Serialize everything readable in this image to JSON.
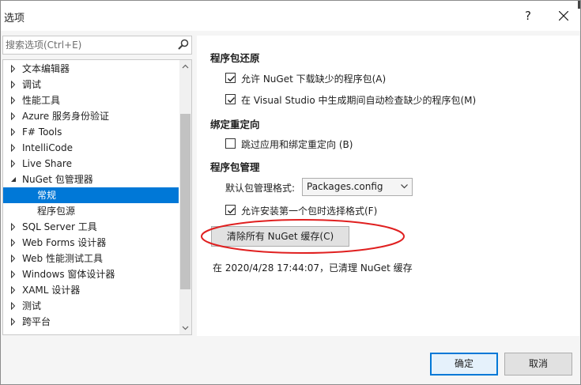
{
  "window": {
    "title": "选项",
    "help": "?"
  },
  "search": {
    "placeholder": "搜索选项(Ctrl+E)"
  },
  "tree": {
    "items": [
      {
        "label": "文本编辑器",
        "expanded": false
      },
      {
        "label": "调试",
        "expanded": false
      },
      {
        "label": "性能工具",
        "expanded": false
      },
      {
        "label": "Azure 服务身份验证",
        "expanded": false
      },
      {
        "label": "F# Tools",
        "expanded": false
      },
      {
        "label": "IntelliCode",
        "expanded": false
      },
      {
        "label": "Live Share",
        "expanded": false
      },
      {
        "label": "NuGet 包管理器",
        "expanded": true
      },
      {
        "label": "常规",
        "child": true,
        "selected": true
      },
      {
        "label": "程序包源",
        "child": true
      },
      {
        "label": "SQL Server 工具",
        "expanded": false
      },
      {
        "label": "Web Forms 设计器",
        "expanded": false
      },
      {
        "label": "Web 性能测试工具",
        "expanded": false
      },
      {
        "label": "Windows 窗体设计器",
        "expanded": false
      },
      {
        "label": "XAML 设计器",
        "expanded": false
      },
      {
        "label": "测试",
        "expanded": false
      },
      {
        "label": "跨平台",
        "expanded": false
      }
    ]
  },
  "panel": {
    "restore": {
      "title": "程序包还原",
      "allow_download": {
        "label": "允许 NuGet 下载缺少的程序包(A)",
        "checked": true
      },
      "check_on_build": {
        "label": "在 Visual Studio 中生成期间自动检查缺少的程序包(M)",
        "checked": true
      }
    },
    "binding": {
      "title": "绑定重定向",
      "skip": {
        "label": "跳过应用和绑定重定向 (B)",
        "checked": false
      }
    },
    "management": {
      "title": "程序包管理",
      "format_label": "默认包管理格式:",
      "format_value": "Packages.config",
      "allow_choose": {
        "label": "允许安装第一个包时选择格式(F)",
        "checked": true
      },
      "clear_button": "清除所有 NuGet 缓存(C)",
      "status": "在 2020/4/28 17:44:07，已清理 NuGet 缓存"
    }
  },
  "footer": {
    "ok": "确定",
    "cancel": "取消"
  },
  "colors": {
    "accent": "#0078d7",
    "annotation": "#e02020"
  }
}
